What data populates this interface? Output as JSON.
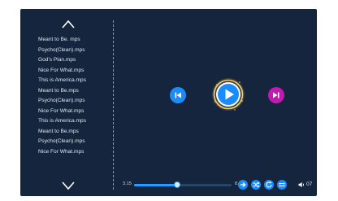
{
  "playlist": {
    "tracks": [
      "Meant to Be. mps",
      "Psycho(Clean).mps",
      "God's Plan.mps",
      "Nice For What.mps",
      "This is America.mps",
      "Meant to Be.mps",
      "Psycho(Clean).mps",
      "Nice For What.mps",
      "This is America.mps",
      "Meant to Be.mps",
      "Psycho(Clean).mps",
      "Nice For What.mps"
    ]
  },
  "player": {
    "elapsed": "3.15",
    "total": "8.15",
    "progress_fraction": 0.44,
    "volume": "07",
    "controls": {
      "previous": "previous-icon",
      "play": "play-icon",
      "next": "next-icon"
    },
    "bottom_buttons": [
      "next-arrow-icon",
      "shuffle-icon",
      "refresh-icon",
      "repeat-icon",
      "volume-icon"
    ]
  },
  "colors": {
    "background": "#14253d",
    "accent_blue": "#1a8cff",
    "accent_magenta": "#c21ab0",
    "divider": "#1ec5d6"
  }
}
